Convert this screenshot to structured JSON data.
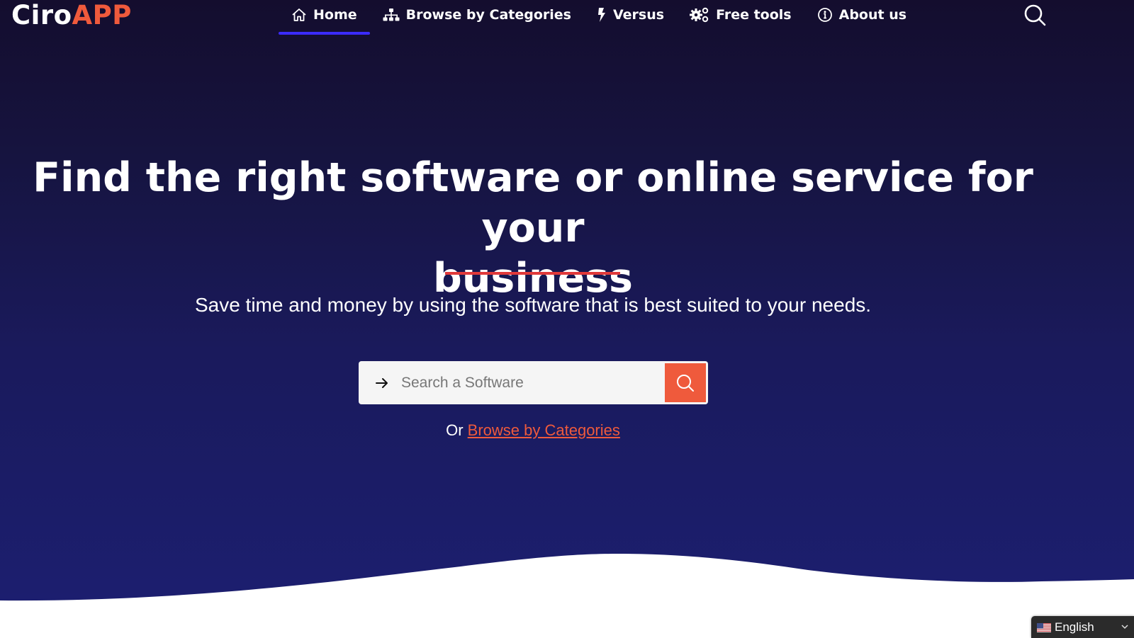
{
  "brand": {
    "part1": "Ciro",
    "part2": "APP",
    "accent_color": "#ef5a3c"
  },
  "nav": {
    "items": [
      {
        "label": "Home",
        "icon": "home-icon",
        "active": true
      },
      {
        "label": "Browse by Categories",
        "icon": "sitemap-icon",
        "active": false
      },
      {
        "label": "Versus",
        "icon": "bolt-icon",
        "active": false
      },
      {
        "label": "Free tools",
        "icon": "gears-icon",
        "active": false
      },
      {
        "label": "About us",
        "icon": "info-icon",
        "active": false
      }
    ],
    "active_indicator_color": "#3b2bff",
    "search_icon": "search-icon"
  },
  "hero": {
    "headline_line1": "Find the right software or online service for your",
    "headline_line2": "business",
    "divider_color": "#e0393a",
    "subtitle": "Save time and money by using the software that is best suited to your needs."
  },
  "search": {
    "placeholder": "Search a Software",
    "value": "",
    "leading_icon": "arrow-right-icon",
    "button_icon": "search-icon",
    "button_color": "#ef5a3c"
  },
  "browse": {
    "prefix": "Or",
    "link_label": "Browse by Categories"
  },
  "language": {
    "selected": "English",
    "flag": "us-flag-icon"
  }
}
